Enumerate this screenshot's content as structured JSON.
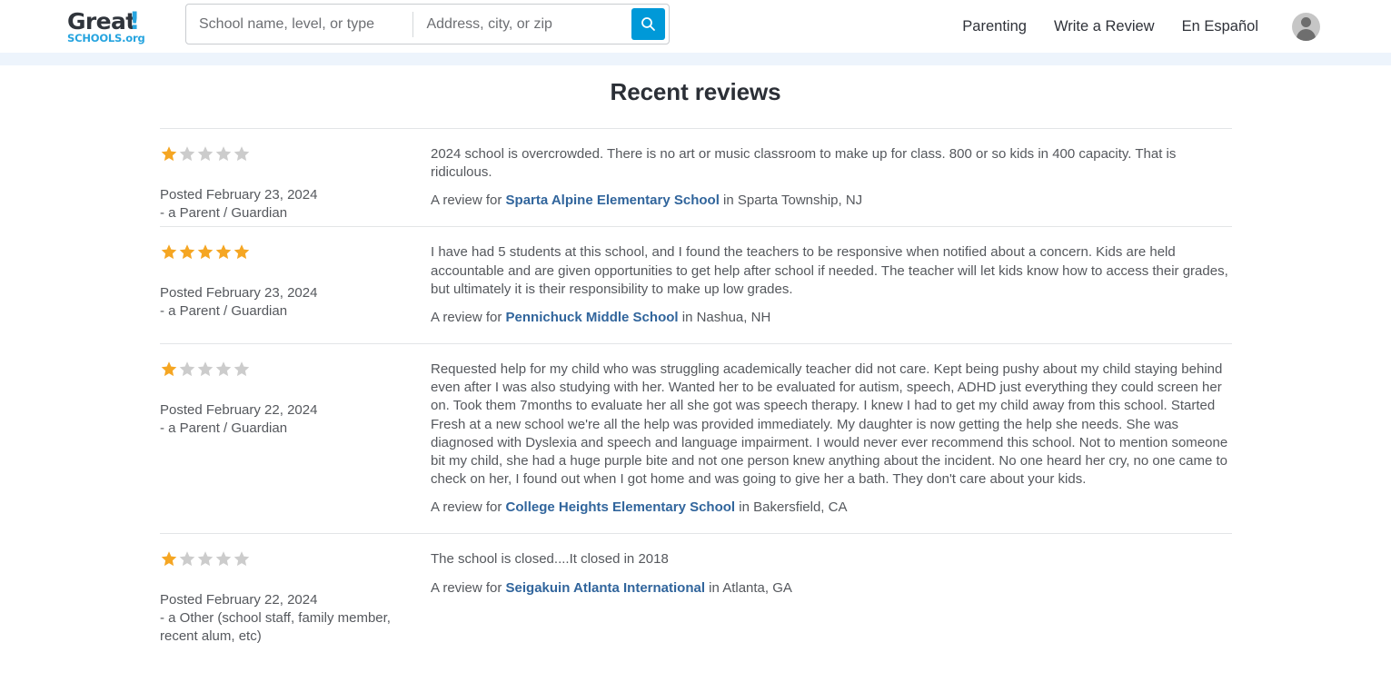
{
  "header": {
    "logo": {
      "word_main": "Great",
      "word_bang": "!",
      "word_sub": "SCHOOLS.org"
    },
    "search": {
      "school_placeholder": "School name, level, or type",
      "school_value": "",
      "address_placeholder": "Address, city, or zip",
      "address_value": "",
      "button_icon": "search-icon"
    },
    "nav": [
      {
        "label": "Parenting"
      },
      {
        "label": "Write a Review"
      },
      {
        "label": "En Español"
      }
    ],
    "avatar_icon": "user-avatar-icon"
  },
  "colors": {
    "brand_blue": "#0099d8",
    "logo_navy": "#30353c",
    "link_blue": "#31659c",
    "star_gold": "#f5a623",
    "star_grey": "#cccccc",
    "band_blue": "#edf4fc"
  },
  "main": {
    "title": "Recent reviews",
    "reviews": [
      {
        "rating": 1,
        "max_rating": 5,
        "posted": "Posted February 23, 2024",
        "author": "- a Parent / Guardian",
        "text": "2024 school is overcrowded. There is no art or music classroom to make up for class. 800 or so kids in 400 capacity. That is ridiculous.",
        "source_prefix": "A review for ",
        "school": "Sparta Alpine Elementary School",
        "location": " in Sparta Township, NJ"
      },
      {
        "rating": 5,
        "max_rating": 5,
        "posted": "Posted February 23, 2024",
        "author": "- a Parent / Guardian",
        "text": "I have had 5 students at this school, and I found the teachers to be responsive when notified about a concern. Kids are held accountable and are given opportunities to get help after school if needed. The teacher will let kids know how to access their grades, but ultimately it is their responsibility to make up low grades.",
        "source_prefix": "A review for ",
        "school": "Pennichuck Middle School",
        "location": " in Nashua, NH"
      },
      {
        "rating": 1,
        "max_rating": 5,
        "posted": "Posted February 22, 2024",
        "author": "- a Parent / Guardian",
        "text": "Requested help for my child who was struggling academically teacher did not care. Kept being pushy about my child staying behind even after I was also studying with her. Wanted her to be evaluated for autism, speech, ADHD just everything they could screen her on. Took them 7months to evaluate her all she got was speech therapy. I knew I had to get my child away from this school. Started Fresh at a new school we're all the help was provided immediately. My daughter is now getting the help she needs. She was diagnosed with Dyslexia and speech and language impairment. I would never ever recommend this school. Not to mention someone bit my child, she had a huge purple bite and not one person knew anything about the incident. No one heard her cry, no one came to check on her, I found out when I got home and was going to give her a bath. They don't care about your kids.",
        "source_prefix": "A review for ",
        "school": "College Heights Elementary School",
        "location": " in Bakersfield, CA"
      },
      {
        "rating": 1,
        "max_rating": 5,
        "posted": "Posted February 22, 2024",
        "author": "- a Other (school staff, family member, recent alum, etc)",
        "text": "The school is closed....It closed in 2018",
        "source_prefix": "A review for ",
        "school": "Seigakuin Atlanta International",
        "location": " in Atlanta, GA"
      }
    ]
  }
}
